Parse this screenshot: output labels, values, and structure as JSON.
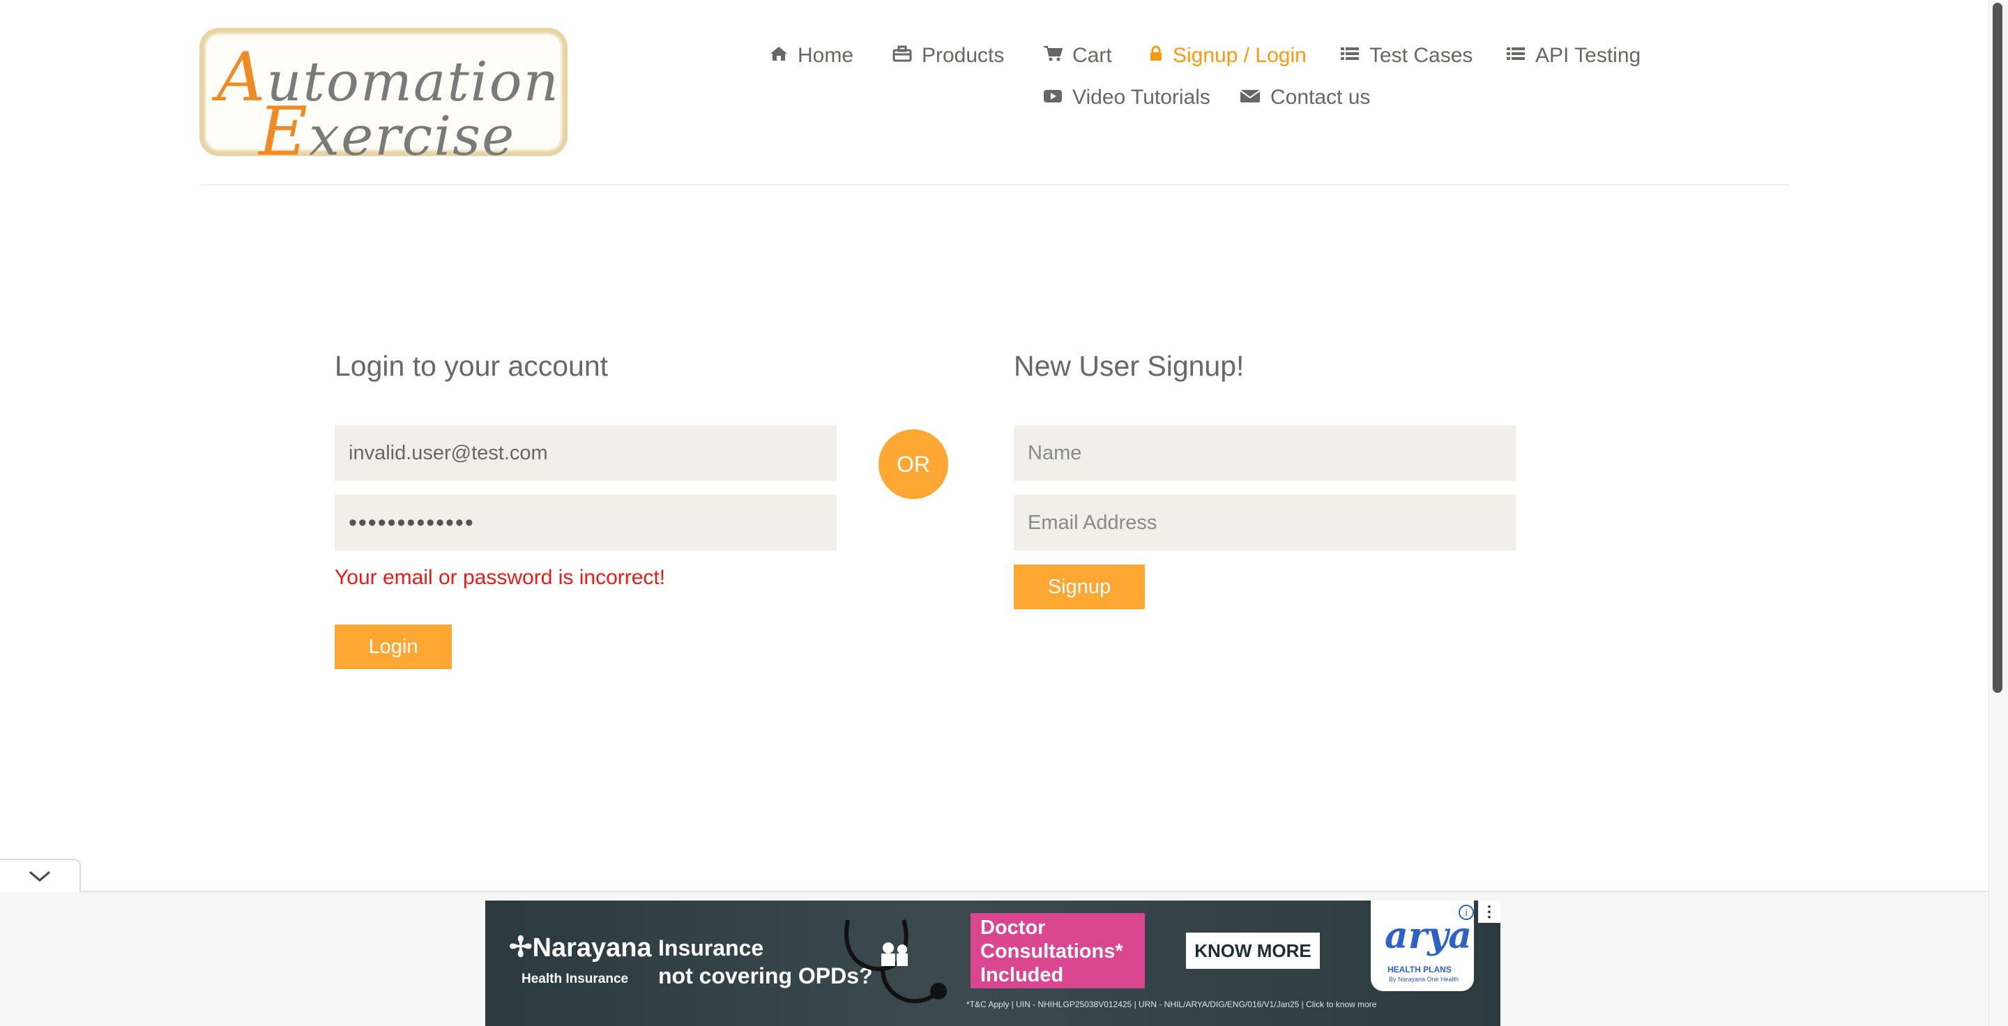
{
  "header": {
    "logo_line1_cap": "A",
    "logo_line1_rest": "utomation",
    "logo_line2_cap": "E",
    "logo_line2_rest": "xercise",
    "nav": [
      {
        "label": "Home",
        "icon": "home-icon"
      },
      {
        "label": "Products",
        "icon": "briefcase-icon"
      },
      {
        "label": "Cart",
        "icon": "cart-icon"
      },
      {
        "label": "Signup / Login",
        "icon": "lock-icon",
        "active": true
      },
      {
        "label": "Test Cases",
        "icon": "list-icon"
      },
      {
        "label": "API Testing",
        "icon": "list-icon"
      },
      {
        "label": "Video Tutorials",
        "icon": "youtube-icon"
      },
      {
        "label": "Contact us",
        "icon": "envelope-icon"
      }
    ]
  },
  "login": {
    "title": "Login to your account",
    "email_value": "invalid.user@test.com",
    "password_masked": "•••••••••••••",
    "error": "Your email or password is incorrect!",
    "button": "Login"
  },
  "divider": "OR",
  "signup": {
    "title": "New User Signup!",
    "name_placeholder": "Name",
    "email_placeholder": "Email Address",
    "button": "Signup"
  },
  "ad": {
    "brand": "Narayana",
    "brand_sub": "Health Insurance",
    "headline_1": "Insurance",
    "headline_2": "not covering OPDs?",
    "promo_1": "Doctor",
    "promo_2": "Consultations*",
    "promo_3": "Included",
    "cta": "KNOW MORE",
    "fine_print": "*T&C Apply | UIN - NHIHLGP25038V012425 | URN - NHIL/ARYA/DIG/ENG/016/V1/Jan25 | Click to know more",
    "partner": "arya",
    "partner_sub": "HEALTH PLANS",
    "partner_tag": "By Narayana One Health"
  },
  "colors": {
    "accent": "#fe980f",
    "error": "#e81b16",
    "text": "#696763",
    "field_bg": "#f0f0e9"
  }
}
